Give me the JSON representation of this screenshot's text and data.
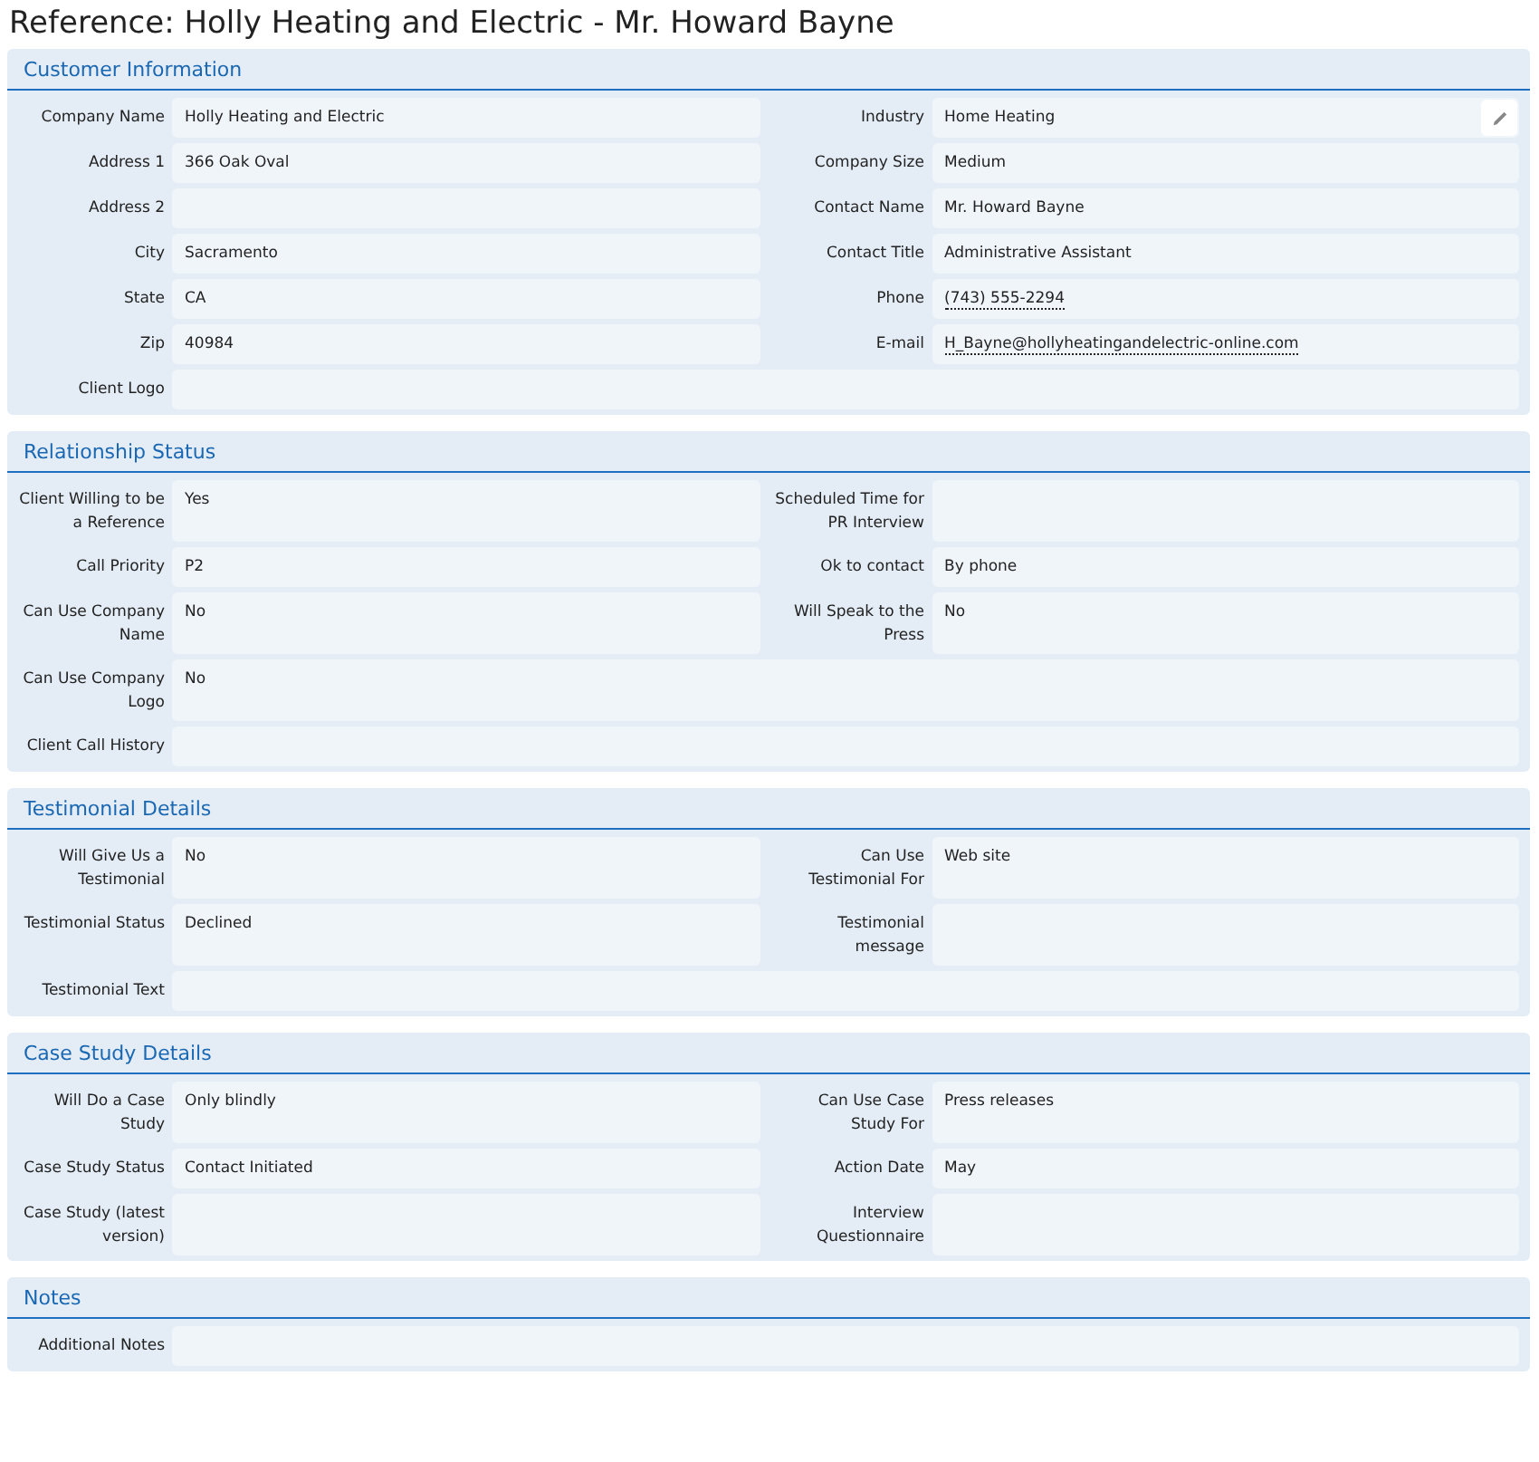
{
  "page_title": "Reference: Holly Heating and Electric - Mr. Howard Bayne",
  "sections": [
    {
      "title": "Customer Information",
      "rows": [
        [
          {
            "label": "Company Name",
            "value": "Holly Heating and Electric",
            "kind": "text"
          },
          {
            "label": "Industry",
            "value": "Home Heating",
            "kind": "editable"
          }
        ],
        [
          {
            "label": "Address 1",
            "value": "366 Oak Oval",
            "kind": "text"
          },
          {
            "label": "Company Size",
            "value": "Medium",
            "kind": "text"
          }
        ],
        [
          {
            "label": "Address 2",
            "kind": "text"
          },
          {
            "label": "Contact Name",
            "value": "Mr. Howard Bayne",
            "kind": "text"
          }
        ],
        [
          {
            "label": "City",
            "value": "Sacramento",
            "kind": "text"
          },
          {
            "label": "Contact Title",
            "value": "Administrative Assistant",
            "kind": "text"
          }
        ],
        [
          {
            "label": "State",
            "value": "CA",
            "kind": "text"
          },
          {
            "label": "Phone",
            "value": "(743) 555-2294",
            "kind": "link"
          }
        ],
        [
          {
            "label": "Zip",
            "value": "40984",
            "kind": "text"
          },
          {
            "label": "E-mail",
            "value": "H_Bayne@hollyheatingandelectric-online.com",
            "kind": "link"
          }
        ],
        [
          {
            "label": "Client Logo",
            "kind": "text"
          }
        ]
      ]
    },
    {
      "title": "Relationship Status",
      "rows": [
        [
          {
            "label": "Client Willing to be a Reference",
            "value": "Yes",
            "kind": "text"
          },
          {
            "label": "Scheduled Time for PR Interview",
            "kind": "text"
          }
        ],
        [
          {
            "label": "Call Priority",
            "value": "P2",
            "kind": "text"
          },
          {
            "label": "Ok to contact",
            "value": "By phone",
            "kind": "text"
          }
        ],
        [
          {
            "label": "Can Use Company Name",
            "value": "No",
            "kind": "text"
          },
          {
            "label": "Will Speak to the Press",
            "value": "No",
            "kind": "text"
          }
        ],
        [
          {
            "label": "Can Use Company Logo",
            "value": "No",
            "kind": "text"
          }
        ],
        [
          {
            "label": "Client Call History",
            "kind": "text"
          }
        ]
      ]
    },
    {
      "title": "Testimonial Details",
      "rows": [
        [
          {
            "label": "Will Give Us a Testimonial",
            "value": "No",
            "kind": "text"
          },
          {
            "label": "Can Use Testimonial For",
            "value": "Web site",
            "kind": "text"
          }
        ],
        [
          {
            "label": "Testimonial Status",
            "value": "Declined",
            "kind": "text"
          },
          {
            "label": "Testimonial message",
            "kind": "text"
          }
        ],
        [
          {
            "label": "Testimonial Text",
            "kind": "text"
          }
        ]
      ]
    },
    {
      "title": "Case Study Details",
      "rows": [
        [
          {
            "label": "Will Do a Case Study",
            "value": "Only blindly",
            "kind": "text"
          },
          {
            "label": "Can Use Case Study For",
            "value": "Press releases",
            "kind": "text"
          }
        ],
        [
          {
            "label": "Case Study Status",
            "value": "Contact Initiated",
            "kind": "text"
          },
          {
            "label": "Action Date",
            "value": "May",
            "kind": "text"
          }
        ],
        [
          {
            "label": "Case Study (latest version)",
            "kind": "text"
          },
          {
            "label": "Interview Questionnaire",
            "kind": "text"
          }
        ]
      ]
    },
    {
      "title": "Notes",
      "rows": [
        [
          {
            "label": "Additional Notes",
            "kind": "text"
          }
        ]
      ]
    }
  ]
}
